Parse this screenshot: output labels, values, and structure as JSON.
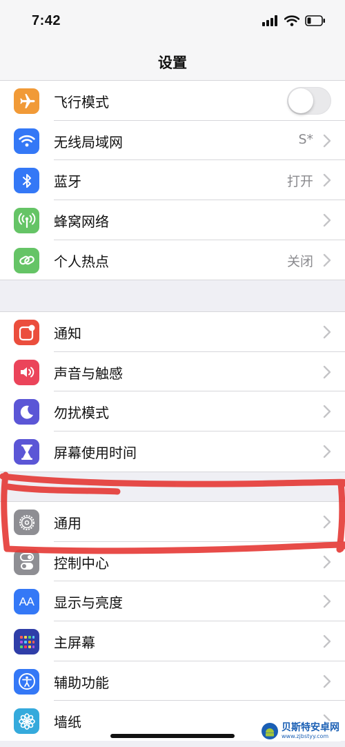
{
  "status": {
    "time": "7:42",
    "icons": [
      "cellular-signal-icon",
      "wifi-icon",
      "battery-low-icon"
    ]
  },
  "nav": {
    "title": "设置"
  },
  "groups": [
    {
      "items": [
        {
          "label": "飞行模式",
          "icon": "airplane-icon",
          "color": "#f19a37",
          "control": "toggle",
          "toggle_on": false
        },
        {
          "label": "无线局域网",
          "icon": "wifi-icon",
          "color": "#3478f6",
          "value": "S*"
        },
        {
          "label": "蓝牙",
          "icon": "bluetooth-icon",
          "color": "#3478f6",
          "value": "打开"
        },
        {
          "label": "蜂窝网络",
          "icon": "antenna-icon",
          "color": "#65c466"
        },
        {
          "label": "个人热点",
          "icon": "hotspot-link-icon",
          "color": "#65c466",
          "value": "关闭"
        }
      ]
    },
    {
      "items": [
        {
          "label": "通知",
          "icon": "notification-icon",
          "color": "#eb4e3d"
        },
        {
          "label": "声音与触感",
          "icon": "speaker-icon",
          "color": "#eb445a"
        },
        {
          "label": "勿扰模式",
          "icon": "moon-icon",
          "color": "#5b56d6"
        },
        {
          "label": "屏幕使用时间",
          "icon": "hourglass-icon",
          "color": "#5b56d6"
        }
      ]
    },
    {
      "items": [
        {
          "label": "通用",
          "icon": "gear-icon",
          "color": "#8e8e93",
          "highlighted": true
        },
        {
          "label": "控制中心",
          "icon": "switches-icon",
          "color": "#8e8e93"
        },
        {
          "label": "显示与亮度",
          "icon": "text-size-icon",
          "color": "#3478f6",
          "icon_text": "AA"
        },
        {
          "label": "主屏幕",
          "icon": "home-grid-icon",
          "color": "#2f3ea8"
        },
        {
          "label": "辅助功能",
          "icon": "accessibility-icon",
          "color": "#3478f6"
        },
        {
          "label": "墙纸",
          "icon": "flower-icon",
          "color": "#35aadc"
        }
      ]
    }
  ],
  "annotation": {
    "color": "#e53935"
  },
  "watermark": {
    "title": "贝斯特安卓网",
    "url": "www.zjbstyy.com"
  }
}
